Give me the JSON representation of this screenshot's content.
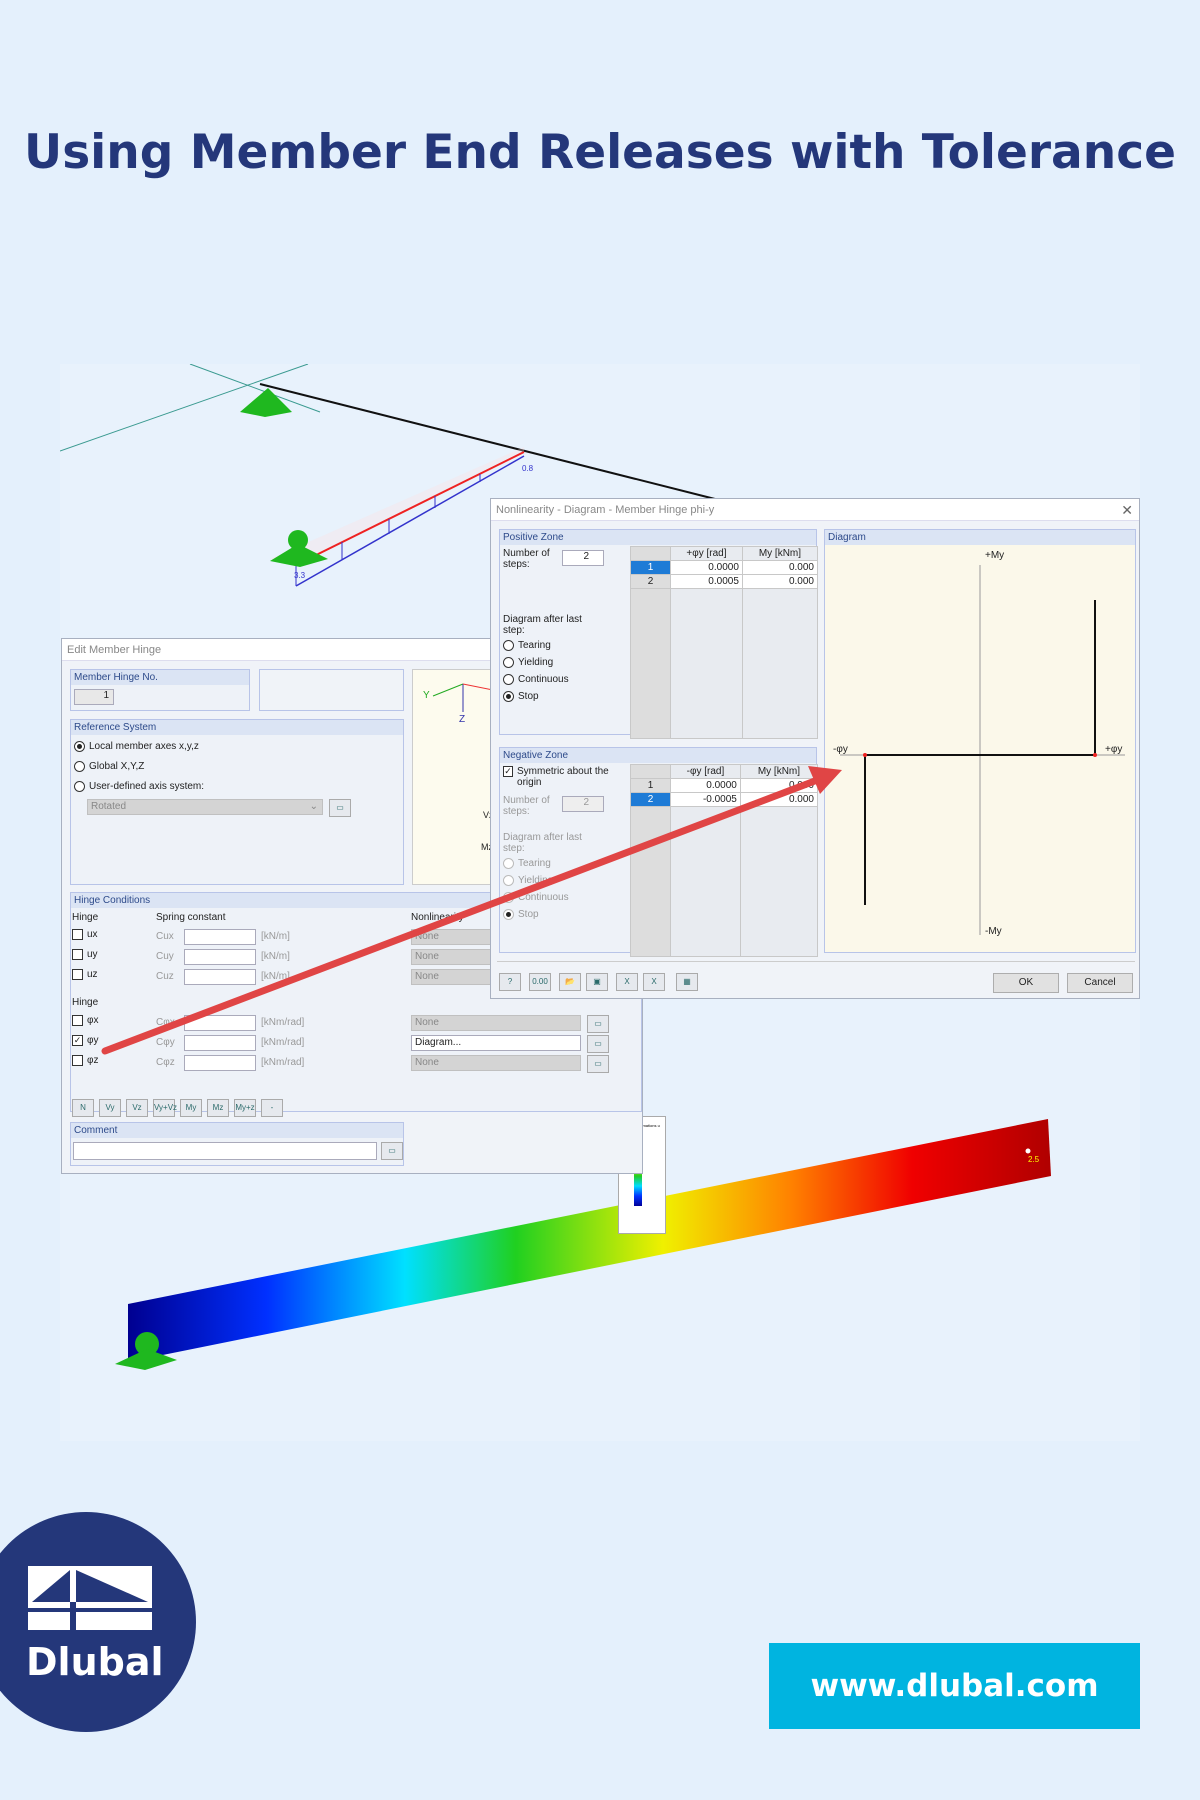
{
  "title": "Using Member End Releases with Tolerance",
  "model_labels": {
    "load_start": "3.3",
    "load_end": "0.8",
    "deform_max": "2.5"
  },
  "edit_hinge": {
    "title": "Edit Member Hinge",
    "hinge_no_label": "Member Hinge No.",
    "hinge_no": "1",
    "reference_system": "Reference System",
    "ref_options": [
      {
        "label": "Local member axes x,y,z",
        "selected": true
      },
      {
        "label": "Global X,Y,Z",
        "selected": false
      },
      {
        "label": "User-defined axis system:",
        "selected": false
      }
    ],
    "axis_system_value": "Rotated",
    "preview_axes": {
      "y": "Y",
      "z": "Z",
      "vz": "Vz",
      "mz": "Mz"
    },
    "hinge_conditions": "Hinge Conditions",
    "col_hinge": "Hinge",
    "col_spring": "Spring constant",
    "col_nonlinear": "Nonlinearity",
    "translational": [
      {
        "dof": "ux",
        "spring": "Cux",
        "unit": "[kN/m]",
        "nonlin": "None",
        "checked": false
      },
      {
        "dof": "uy",
        "spring": "Cuy",
        "unit": "[kN/m]",
        "nonlin": "None",
        "checked": false
      },
      {
        "dof": "uz",
        "spring": "Cuz",
        "unit": "[kN/m]",
        "nonlin": "None",
        "checked": false
      }
    ],
    "rot_header": "Hinge",
    "rotational": [
      {
        "dof": "φx",
        "spring": "Cφx",
        "unit": "[kNm/rad]",
        "nonlin": "None",
        "checked": false
      },
      {
        "dof": "φy",
        "spring": "Cφy",
        "unit": "[kNm/rad]",
        "nonlin": "Diagram...",
        "checked": true
      },
      {
        "dof": "φz",
        "spring": "Cφz",
        "unit": "[kNm/rad]",
        "nonlin": "None",
        "checked": false
      }
    ],
    "toolbar": [
      "N",
      "Vy",
      "Vz",
      "Vy+Vz",
      "My",
      "Mz",
      "My+z",
      "-"
    ],
    "comment_label": "Comment",
    "comment_value": ""
  },
  "nonlinearity": {
    "title": "Nonlinearity - Diagram - Member Hinge phi-y",
    "positive": {
      "header": "Positive Zone",
      "steps_label": "Number of steps:",
      "steps": "2",
      "after_label": "Diagram after last step:",
      "options": [
        {
          "label": "Tearing",
          "selected": false
        },
        {
          "label": "Yielding",
          "selected": false
        },
        {
          "label": "Continuous",
          "selected": false
        },
        {
          "label": "Stop",
          "selected": true
        }
      ],
      "col_phi": "+φy [rad]",
      "col_m": "My [kNm]",
      "rows": [
        {
          "n": "1",
          "phi": "0.0000",
          "m": "0.000"
        },
        {
          "n": "2",
          "phi": "0.0005",
          "m": "0.000"
        }
      ]
    },
    "negative": {
      "header": "Negative Zone",
      "symmetric_label": "Symmetric about the origin",
      "symmetric": true,
      "steps_label": "Number of steps:",
      "steps": "2",
      "after_label": "Diagram after last step:",
      "options": [
        {
          "label": "Tearing",
          "selected": false
        },
        {
          "label": "Yielding",
          "selected": false
        },
        {
          "label": "Continuous",
          "selected": false
        },
        {
          "label": "Stop",
          "selected": true
        }
      ],
      "col_phi": "-φy [rad]",
      "col_m": "My [kNm]",
      "rows": [
        {
          "n": "1",
          "phi": "0.0000",
          "m": "0.000"
        },
        {
          "n": "2",
          "phi": "-0.0005",
          "m": "0.000"
        }
      ]
    },
    "diagram": {
      "header": "Diagram",
      "plus_m": "+My",
      "minus_m": "-My",
      "plus_phi": "+φy",
      "minus_phi": "-φy"
    },
    "ok": "OK",
    "cancel": "Cancel"
  },
  "legend_panel": {
    "title": "Panel",
    "subtitle": "Global Deformations u [mm]"
  },
  "brand": {
    "name": "Dlubal",
    "url": "www.dlubal.com",
    "color": "#24377a",
    "accent": "#00b4e0"
  }
}
